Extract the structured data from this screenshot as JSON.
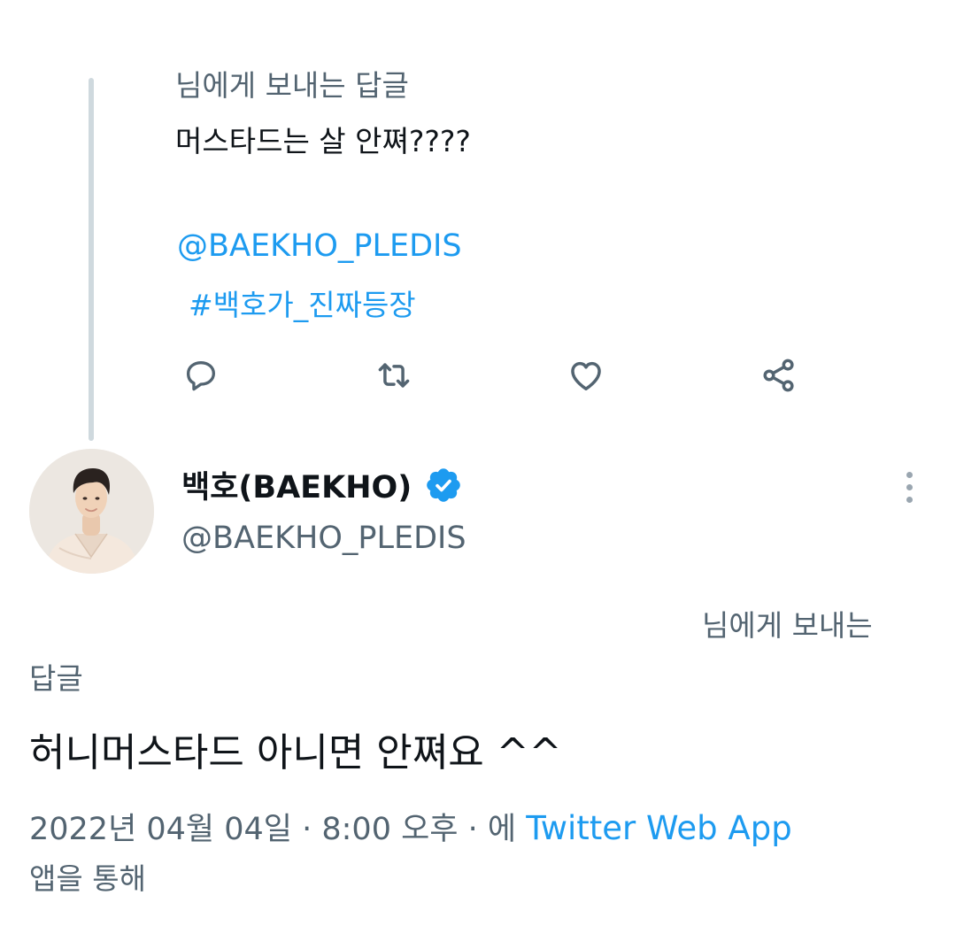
{
  "parent_tweet": {
    "reply_context": "님에게 보내는 답글",
    "body": "머스타드는 살 안쪄????",
    "mention": "@BAEKHO_PLEDIS",
    "hashtag": "#백호가_진짜등장",
    "actions": [
      {
        "name": "reply",
        "icon": "reply-icon"
      },
      {
        "name": "retweet",
        "icon": "retweet-icon"
      },
      {
        "name": "like",
        "icon": "heart-icon"
      },
      {
        "name": "share",
        "icon": "share-icon"
      }
    ]
  },
  "main_tweet": {
    "author": {
      "display_name": "백호(BAEKHO)",
      "handle": "@BAEKHO_PLEDIS",
      "verified": true,
      "avatar_icon": "profile-photo"
    },
    "reply_context_line1": "님에게 보내는",
    "reply_context_line2": "답글",
    "body": "허니머스타드 아니면 안쪄요 ^^",
    "timestamp": "2022년 04월 04일 · 8:00 오후 · 에",
    "source": "Twitter Web App",
    "via_suffix": "앱을 통해"
  },
  "colors": {
    "link": "#1d9bf0",
    "secondary_text": "#536471",
    "primary_text": "#0f1419",
    "thread_line": "#cfd9de"
  }
}
